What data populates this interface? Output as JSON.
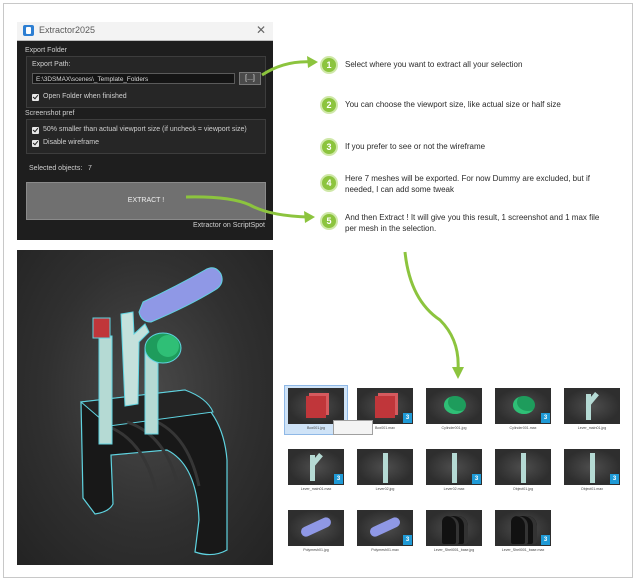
{
  "window": {
    "title": "Extractor2025",
    "export_folder": {
      "heading": "Export Folder",
      "path_label": "Export Path:",
      "path_value": "E:\\3DSMAX\\scenes\\_Template_Folders",
      "browse_label": "[...]",
      "open_folder_label": "Open Folder when finished",
      "open_folder_checked": true
    },
    "screenshot_pref": {
      "heading": "Screenshot pref",
      "smaller_label": "50% smaller than actual viewport size (if uncheck = viewport size)",
      "smaller_checked": true,
      "wireframe_label": "Disable wireframe",
      "wireframe_checked": true
    },
    "selected_label": "Selected objects:",
    "selected_count": "7",
    "extract_label": "EXTRACT !",
    "footer": "Extractor on ScriptSpot"
  },
  "steps": [
    {
      "num": "1",
      "text": "Select where you want to extract all your selection"
    },
    {
      "num": "2",
      "text": "You can choose the viewport size, like actual size or half size"
    },
    {
      "num": "3",
      "text": "If you prefer to see or not the wireframe"
    },
    {
      "num": "4",
      "text": "Here 7 meshes will be exported. For now Dummy are excluded, but if needed, I can add some tweak"
    },
    {
      "num": "5",
      "text": "And then Extract ! It will give you this result, 1 screenshot and 1 max file per mesh in the selection."
    }
  ],
  "colors": {
    "accent_green": "#8cc43e",
    "max_badge": "#1f9ad6",
    "selection_outline": "#5fd3e0"
  },
  "results": [
    {
      "name": "Box001.jpg",
      "type": "image",
      "object": "red-box",
      "selected": true
    },
    {
      "name": "Box001.max",
      "type": "max",
      "object": "red-box"
    },
    {
      "name": "Cylinder001.jpg",
      "type": "image",
      "object": "green-cylinder"
    },
    {
      "name": "Cylinder001.max",
      "type": "max",
      "object": "green-cylinder"
    },
    {
      "name": "Lever_main01.jpg",
      "type": "image",
      "object": "bent-lever"
    },
    {
      "name": "Lever_main01.max",
      "type": "max",
      "object": "bent-lever"
    },
    {
      "name": "Lever02.jpg",
      "type": "image",
      "object": "straight-lever"
    },
    {
      "name": "Lever02.max",
      "type": "max",
      "object": "straight-lever"
    },
    {
      "name": "Object01.jpg",
      "type": "image",
      "object": "straight-lever"
    },
    {
      "name": "Object01.max",
      "type": "max",
      "object": "straight-lever"
    },
    {
      "name": "Polymesh01.jpg",
      "type": "image",
      "object": "blue-handle"
    },
    {
      "name": "Polymesh01.max",
      "type": "max",
      "object": "blue-handle"
    },
    {
      "name": "Lever_Shell001_base.jpg",
      "type": "image",
      "object": "black-base"
    },
    {
      "name": "Lever_Shell001_base.max",
      "type": "max",
      "object": "black-base"
    }
  ],
  "badge_label": "3"
}
